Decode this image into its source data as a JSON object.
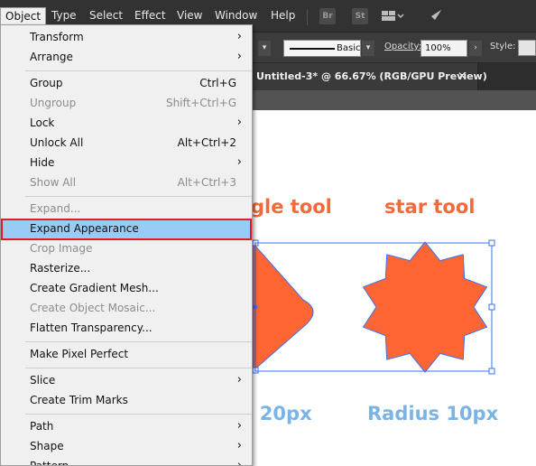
{
  "menubar": {
    "items": [
      "Object",
      "Type",
      "Select",
      "Effect",
      "View",
      "Window",
      "Help"
    ],
    "active": "Object",
    "app_badges": [
      "Br",
      "St"
    ]
  },
  "control_bar": {
    "stroke_style_label": "Basic",
    "opacity_label": "Opacity:",
    "opacity_value": "100%",
    "style_label": "Style:"
  },
  "document": {
    "tab_title": "Untitled-3* @ 66.67% (RGB/GPU Preview)",
    "close_glyph": "✕"
  },
  "artboard": {
    "heading_left": "gle tool",
    "heading_right": "star tool",
    "caption_left": "s 20px",
    "caption_right": "Radius 10px",
    "shape_fill": "#ff6633",
    "heading_color": "#f26a3a",
    "caption_color": "#7ab4e6",
    "selection_color": "#3d6ff0"
  },
  "object_menu": {
    "groups": [
      [
        {
          "label": "Transform",
          "submenu": true
        },
        {
          "label": "Arrange",
          "submenu": true
        }
      ],
      [
        {
          "label": "Group",
          "shortcut": "Ctrl+G"
        },
        {
          "label": "Ungroup",
          "shortcut": "Shift+Ctrl+G",
          "disabled": true
        },
        {
          "label": "Lock",
          "submenu": true
        },
        {
          "label": "Unlock All",
          "shortcut": "Alt+Ctrl+2"
        },
        {
          "label": "Hide",
          "submenu": true
        },
        {
          "label": "Show All",
          "shortcut": "Alt+Ctrl+3",
          "disabled": true
        }
      ],
      [
        {
          "label": "Expand...",
          "disabled": true
        },
        {
          "label": "Expand Appearance",
          "highlighted": true
        },
        {
          "label": "Crop Image",
          "disabled": true
        },
        {
          "label": "Rasterize..."
        },
        {
          "label": "Create Gradient Mesh..."
        },
        {
          "label": "Create Object Mosaic...",
          "disabled": true
        },
        {
          "label": "Flatten Transparency..."
        }
      ],
      [
        {
          "label": "Make Pixel Perfect"
        }
      ],
      [
        {
          "label": "Slice",
          "submenu": true
        },
        {
          "label": "Create Trim Marks"
        }
      ],
      [
        {
          "label": "Path",
          "submenu": true
        },
        {
          "label": "Shape",
          "submenu": true
        },
        {
          "label": "Pattern",
          "submenu": true
        }
      ]
    ]
  },
  "colors": {
    "menu_highlight": "#99ccf4",
    "annotation_border": "#e11b2a",
    "menubar_bg": "#323232"
  }
}
